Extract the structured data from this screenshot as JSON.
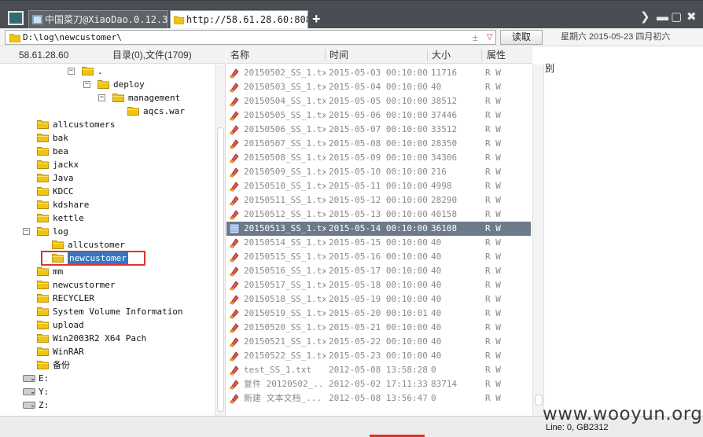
{
  "tabs": [
    {
      "label": "中国菜刀@XiaoDao.0.12.30",
      "active": false
    },
    {
      "label": "http://58.61.28.60:808...",
      "active": true
    }
  ],
  "address": {
    "path": "D:\\log\\newcustomer\\",
    "star": "±",
    "dropdown": "▽",
    "read_button": "读取",
    "date": "星期六 2015-05-23 四月初六"
  },
  "left_header": {
    "ip": "58.61.28.60",
    "summary": "目录(0),文件(1709)"
  },
  "columns": {
    "name": "名称",
    "time": "时间",
    "size": "大小",
    "attr": "属性"
  },
  "tree": [
    {
      "label": ".",
      "expander": "−"
    },
    {
      "label": "deploy",
      "expander": "−"
    },
    {
      "label": "management",
      "expander": "−"
    },
    {
      "label": "aqcs.war",
      "expander": ""
    },
    {
      "label": "allcustomers",
      "expander": ""
    },
    {
      "label": "bak",
      "expander": ""
    },
    {
      "label": "bea",
      "expander": ""
    },
    {
      "label": "jackx",
      "expander": ""
    },
    {
      "label": "Java",
      "expander": ""
    },
    {
      "label": "KDCC",
      "expander": ""
    },
    {
      "label": "kdshare",
      "expander": ""
    },
    {
      "label": "kettle",
      "expander": ""
    },
    {
      "label": "log",
      "expander": "−"
    },
    {
      "label": "allcustomer",
      "expander": ""
    },
    {
      "label": "newcustomer",
      "expander": ""
    },
    {
      "label": "mm",
      "expander": ""
    },
    {
      "label": "newcustormer",
      "expander": ""
    },
    {
      "label": "RECYCLER",
      "expander": ""
    },
    {
      "label": "System Volume Information",
      "expander": ""
    },
    {
      "label": "upload",
      "expander": ""
    },
    {
      "label": "Win2003R2 X64 Pach",
      "expander": ""
    },
    {
      "label": "WinRAR",
      "expander": ""
    },
    {
      "label": "备份",
      "expander": ""
    },
    {
      "label": "E:",
      "expander": ""
    },
    {
      "label": "Y:",
      "expander": ""
    },
    {
      "label": "Z:",
      "expander": ""
    }
  ],
  "files": [
    {
      "name": "20150502_SS_1.txt",
      "time": "2015-05-03 00:10:00",
      "size": "11716",
      "attr": "R W"
    },
    {
      "name": "20150503_SS_1.txt",
      "time": "2015-05-04 00:10:00",
      "size": "40",
      "attr": "R W"
    },
    {
      "name": "20150504_SS_1.txt",
      "time": "2015-05-05 00:10:00",
      "size": "38512",
      "attr": "R W"
    },
    {
      "name": "20150505_SS_1.txt",
      "time": "2015-05-06 00:10:00",
      "size": "37446",
      "attr": "R W"
    },
    {
      "name": "20150506_SS_1.txt",
      "time": "2015-05-07 00:10:00",
      "size": "33512",
      "attr": "R W"
    },
    {
      "name": "20150507_SS_1.txt",
      "time": "2015-05-08 00:10:00",
      "size": "28350",
      "attr": "R W"
    },
    {
      "name": "20150508_SS_1.txt",
      "time": "2015-05-09 00:10:00",
      "size": "34306",
      "attr": "R W"
    },
    {
      "name": "20150509_SS_1.txt",
      "time": "2015-05-10 00:10:00",
      "size": "216",
      "attr": "R W"
    },
    {
      "name": "20150510_SS_1.txt",
      "time": "2015-05-11 00:10:00",
      "size": "4998",
      "attr": "R W"
    },
    {
      "name": "20150511_SS_1.txt",
      "time": "2015-05-12 00:10:00",
      "size": "28290",
      "attr": "R W"
    },
    {
      "name": "20150512_SS_1.txt",
      "time": "2015-05-13 00:10:00",
      "size": "40158",
      "attr": "R W"
    },
    {
      "name": "20150513_SS_1.txt",
      "time": "2015-05-14 00:10:00",
      "size": "36108",
      "attr": "R W",
      "selected": true
    },
    {
      "name": "20150514_SS_1.txt",
      "time": "2015-05-15 00:10:00",
      "size": "40",
      "attr": "R W"
    },
    {
      "name": "20150515_SS_1.txt",
      "time": "2015-05-16 00:10:00",
      "size": "40",
      "attr": "R W"
    },
    {
      "name": "20150516_SS_1.txt",
      "time": "2015-05-17 00:10:00",
      "size": "40",
      "attr": "R W"
    },
    {
      "name": "20150517_SS_1.txt",
      "time": "2015-05-18 00:10:00",
      "size": "40",
      "attr": "R W"
    },
    {
      "name": "20150518_SS_1.txt",
      "time": "2015-05-19 00:10:00",
      "size": "40",
      "attr": "R W"
    },
    {
      "name": "20150519_SS_1.txt",
      "time": "2015-05-20 00:10:01",
      "size": "40",
      "attr": "R W"
    },
    {
      "name": "20150520_SS_1.txt",
      "time": "2015-05-21 00:10:00",
      "size": "40",
      "attr": "R W"
    },
    {
      "name": "20150521_SS_1.txt",
      "time": "2015-05-22 00:10:00",
      "size": "40",
      "attr": "R W"
    },
    {
      "name": "20150522_SS_1.txt",
      "time": "2015-05-23 00:10:00",
      "size": "40",
      "attr": "R W"
    },
    {
      "name": "test_SS_1.txt",
      "time": "2012-05-08 13:58:28",
      "size": "0",
      "attr": "R W"
    },
    {
      "name": "复件 20120502_...",
      "time": "2012-05-02 17:11:33",
      "size": "83714",
      "attr": "R W"
    },
    {
      "name": "新建 文本文档_...",
      "time": "2012-05-08 13:56:47",
      "size": "0",
      "attr": "R W"
    }
  ],
  "text_panel": {
    "content": "别"
  },
  "watermark": "www.wooyun.org",
  "status": {
    "right": "Line: 0, GB2312"
  },
  "colors": {
    "tabbar": "#4a4e54",
    "selected_row": "#6c7a89",
    "highlight_box": "#dd3333",
    "folder": "#f1c40f"
  }
}
